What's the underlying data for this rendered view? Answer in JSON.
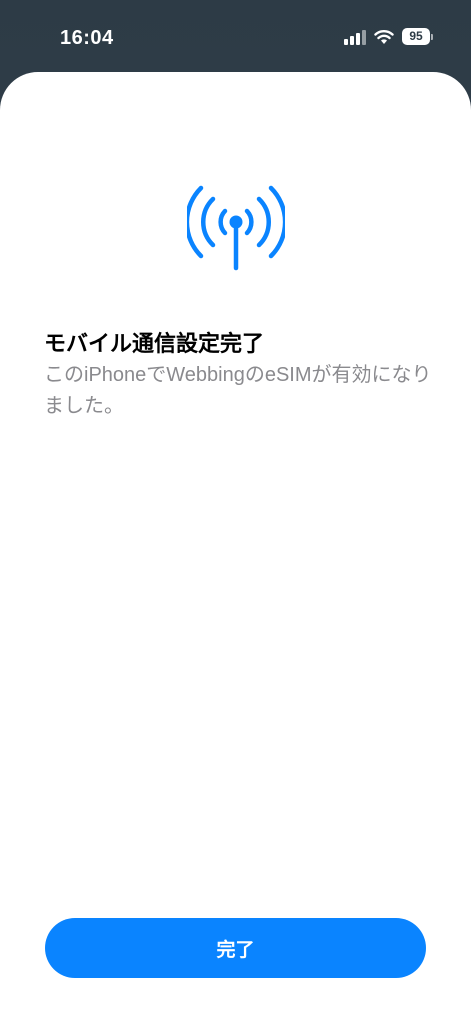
{
  "status_bar": {
    "time": "16:04",
    "battery": "95"
  },
  "content": {
    "title": "モバイル通信設定完了",
    "description": "このiPhoneでWebbingのeSIMが有効になりました。"
  },
  "actions": {
    "done_label": "完了"
  },
  "colors": {
    "accent": "#0a84ff",
    "secondary_text": "#8a8a8e"
  }
}
